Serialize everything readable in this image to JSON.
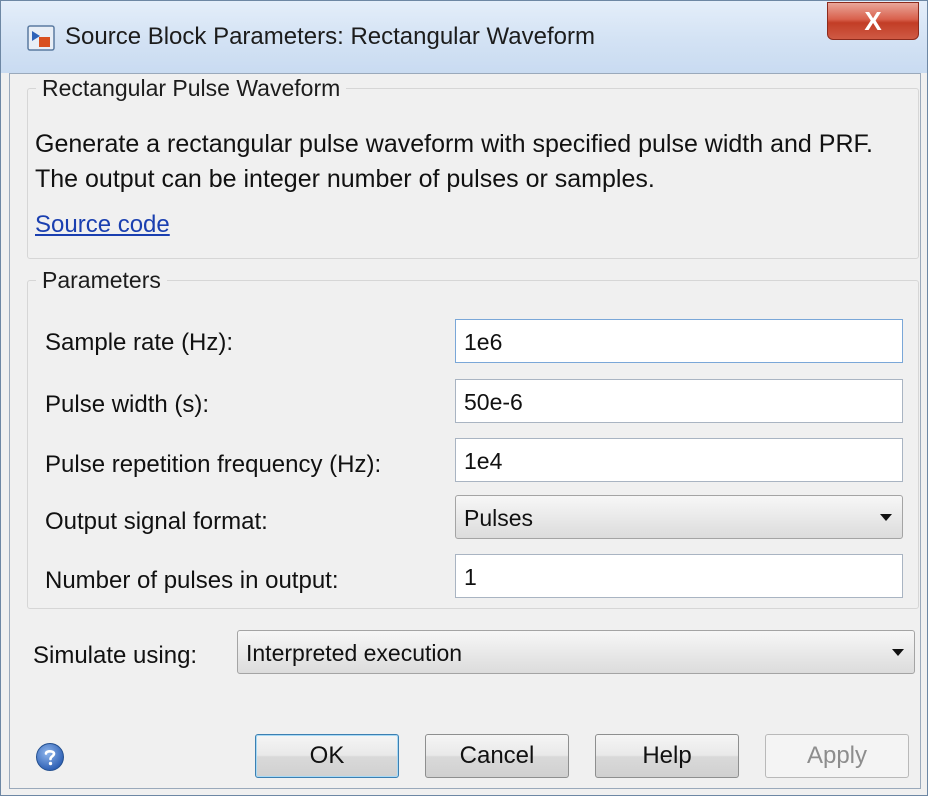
{
  "window": {
    "title": "Source Block Parameters: Rectangular Waveform",
    "close_label": "X"
  },
  "description_group": {
    "legend": "Rectangular Pulse Waveform",
    "text": "Generate a rectangular pulse waveform with specified pulse width and PRF. The output can be integer number of pulses or samples.",
    "link": "Source code"
  },
  "parameters": {
    "legend": "Parameters",
    "sample_rate": {
      "label": "Sample rate (Hz):",
      "value": "1e6"
    },
    "pulse_width": {
      "label": "Pulse width (s):",
      "value": "50e-6"
    },
    "prf": {
      "label": "Pulse repetition frequency (Hz):",
      "value": "1e4"
    },
    "output_format": {
      "label": "Output signal format:",
      "value": "Pulses"
    },
    "num_pulses": {
      "label": "Number of pulses in output:",
      "value": "1"
    }
  },
  "simulate": {
    "label": "Simulate using:",
    "value": "Interpreted execution"
  },
  "buttons": {
    "ok": "OK",
    "cancel": "Cancel",
    "help": "Help",
    "apply": "Apply"
  },
  "icons": {
    "app": "simulink-block-icon",
    "help": "help-question-icon",
    "close": "close-icon"
  }
}
